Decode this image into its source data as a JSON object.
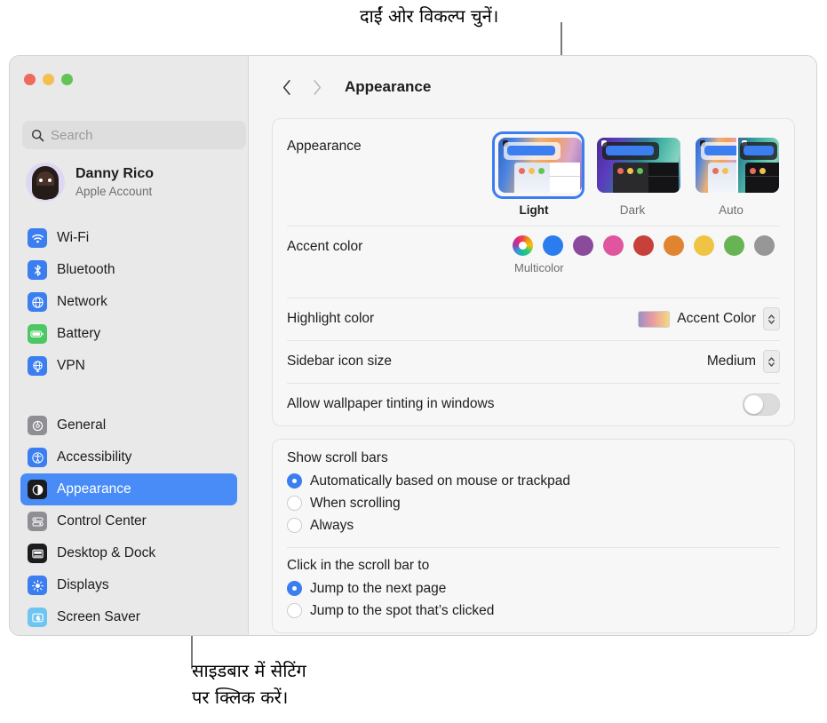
{
  "annotations": {
    "top": {
      "text": "दाईं ओर विकल्प चुनें।"
    },
    "bottom": {
      "text": "साइडबार में सेटिंग\nपर क्लिक करें।"
    }
  },
  "window": {
    "traffic_lights": [
      "close",
      "minimize",
      "maximize"
    ]
  },
  "sidebar": {
    "search": {
      "placeholder": "Search",
      "value": "",
      "icon": "search-icon"
    },
    "account": {
      "name": "Danny Rico",
      "subtitle": "Apple Account",
      "avatar": "avatar"
    },
    "group1": [
      {
        "label": "Wi-Fi",
        "icon": "wifi-icon",
        "color": "#3b7ef0",
        "selected": false
      },
      {
        "label": "Bluetooth",
        "icon": "bluetooth-icon",
        "color": "#3b7ef0",
        "selected": false
      },
      {
        "label": "Network",
        "icon": "globe-icon",
        "color": "#3b7ef0",
        "selected": false
      },
      {
        "label": "Battery",
        "icon": "battery-icon",
        "color": "#4cc764",
        "selected": false
      },
      {
        "label": "VPN",
        "icon": "vpn-icon",
        "color": "#3b7ef0",
        "selected": false
      }
    ],
    "group2": [
      {
        "label": "General",
        "icon": "gear-icon",
        "color": "#8e8e93",
        "selected": false
      },
      {
        "label": "Accessibility",
        "icon": "accessibility-icon",
        "color": "#3b7ef0",
        "selected": false
      },
      {
        "label": "Appearance",
        "icon": "appearance-icon",
        "color": "#1c1c1e",
        "selected": true
      },
      {
        "label": "Control Center",
        "icon": "control-center-icon",
        "color": "#8e8e93",
        "selected": false
      },
      {
        "label": "Desktop & Dock",
        "icon": "desktop-dock-icon",
        "color": "#1c1c1e",
        "selected": false
      },
      {
        "label": "Displays",
        "icon": "displays-icon",
        "color": "#3b7ef0",
        "selected": false
      },
      {
        "label": "Screen Saver",
        "icon": "screen-saver-icon",
        "color": "#6ec5ef",
        "selected": false
      }
    ]
  },
  "toolbar": {
    "back_icon": "chevron-left-icon",
    "forward_icon": "chevron-right-icon",
    "title": "Appearance"
  },
  "main": {
    "appearance": {
      "label": "Appearance",
      "modes": [
        {
          "label": "Light",
          "selected": true
        },
        {
          "label": "Dark",
          "selected": false
        },
        {
          "label": "Auto",
          "selected": false
        }
      ]
    },
    "accent_color": {
      "label": "Accent color",
      "selected_label": "Multicolor",
      "swatches": [
        {
          "name": "multicolor",
          "color": "multicolor",
          "selected": true
        },
        {
          "name": "blue",
          "color": "#2b7def",
          "selected": false
        },
        {
          "name": "purple",
          "color": "#8a4b9c",
          "selected": false
        },
        {
          "name": "pink",
          "color": "#e0559e",
          "selected": false
        },
        {
          "name": "red",
          "color": "#c8403c",
          "selected": false
        },
        {
          "name": "orange",
          "color": "#e08430",
          "selected": false
        },
        {
          "name": "yellow",
          "color": "#efc444",
          "selected": false
        },
        {
          "name": "green",
          "color": "#68b455",
          "selected": false
        },
        {
          "name": "graphite",
          "color": "#979797",
          "selected": false
        }
      ]
    },
    "highlight_color": {
      "label": "Highlight color",
      "value": "Accent Color"
    },
    "sidebar_icon_size": {
      "label": "Sidebar icon size",
      "value": "Medium"
    },
    "wallpaper_tinting": {
      "label": "Allow wallpaper tinting in windows",
      "enabled": false
    },
    "show_scroll_bars": {
      "title": "Show scroll bars",
      "options": [
        {
          "label": "Automatically based on mouse or trackpad",
          "selected": true
        },
        {
          "label": "When scrolling",
          "selected": false
        },
        {
          "label": "Always",
          "selected": false
        }
      ]
    },
    "click_scroll_bar": {
      "title": "Click in the scroll bar to",
      "options": [
        {
          "label": "Jump to the next page",
          "selected": true
        },
        {
          "label": "Jump to the spot that’s clicked",
          "selected": false
        }
      ]
    }
  }
}
